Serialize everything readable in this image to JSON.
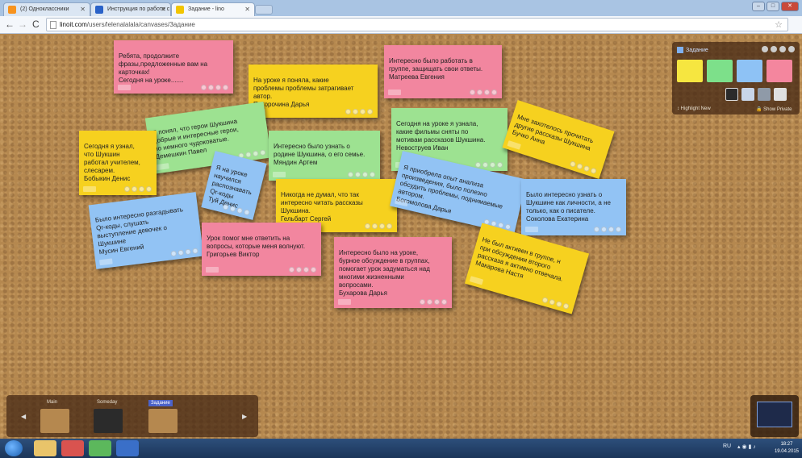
{
  "tabs": [
    {
      "label": "(2) Одноклассники",
      "icon_color": "#f7931e"
    },
    {
      "label": "Инструкция по работе с",
      "icon_color": "#2a62c8"
    },
    {
      "label": "Задание - lino",
      "icon_color": "#f2c500"
    }
  ],
  "address": {
    "host": "linoit.com",
    "path": "/users/lelenalalala/canvases/Задание"
  },
  "panel": {
    "title": "Задание",
    "highlight_label": "Highlight New",
    "private_label": "Show Private"
  },
  "tray": {
    "canvases": [
      "Main",
      "Someday",
      "Задание"
    ]
  },
  "notes": [
    {
      "color": "pink",
      "text": "Ребята, продолжите\nфразы,предложенные вам на\nкарточках!\nСегодня на уроке......."
    },
    {
      "color": "yellow",
      "text": "На уроке я поняла, какие\nпроблемы проблемы затрагивает\nавтор.\nПоторочина Дарья"
    },
    {
      "color": "pink",
      "text": "Интересно было работать в\nгруппе, защищать свои ответы.\nМатреева Евгения"
    },
    {
      "color": "green",
      "text": "Я понял, что герои Шукшина\nдобрые и интересные герои,\nно немного чудоковатые.\nДемешкин Павел"
    },
    {
      "color": "yellow",
      "text": "Сегодня я узнал,\nчто Шукшин\nработал учителем,\nслесарем.\nБобыкин Денис"
    },
    {
      "color": "green",
      "text": "Интересно было узнать о\nродине Шукшина, о его семье.\nМяндин Артем"
    },
    {
      "color": "green",
      "text": "Сегодня на уроке я узнала,\nкакие фильмы сняты по\nмотивам рассказов Шукшина.\nНевоструев Иван"
    },
    {
      "color": "yellow",
      "text": "Мне захотелось прочитать\nдругие рассказы Шукшина\nБучко Анна"
    },
    {
      "color": "blue",
      "text": "Я на уроке\nнаучился\nраспознавать\nQr-коды\nТуй Денис"
    },
    {
      "color": "yellow",
      "text": "Никогда не думал, что так\nинтересно читать рассказы\nШукшина.\nГельбарт Сергей"
    },
    {
      "color": "blue",
      "text": "Я приобрела опыт анализа\nпроизведения, было полезно\nобсудить проблемы, поднимаемые\nавтором.\nБогомолова Дарья"
    },
    {
      "color": "blue",
      "text": "Было интересно узнать о\nШукшине как личности, а не\nтолько, как о писателе.\nСоколова Екатерина"
    },
    {
      "color": "blue",
      "text": "Было интересно разгадывать\nQr-коды, слушать\nвыступление девочек о\nШукшине\nМусин Евгений"
    },
    {
      "color": "pink",
      "text": "Урок помог мне ответить на\nвопросы, которые меня волнуют.\nГригорьев Виктор"
    },
    {
      "color": "pink",
      "text": "Интересно было на уроке,\nбурное обсуждение в группах,\nпомогает урок задуматься над\nмногими жизненными\nвопросами.\nБухарова Дарья"
    },
    {
      "color": "yellow",
      "text": "Не был активен в группе, н\nпри обсуждении второго\nрассказа я активно отвечала.\nМакарова Настя"
    }
  ],
  "taskbar": {
    "lang": "RU",
    "time": "18:27",
    "date": "19.04.2015"
  }
}
